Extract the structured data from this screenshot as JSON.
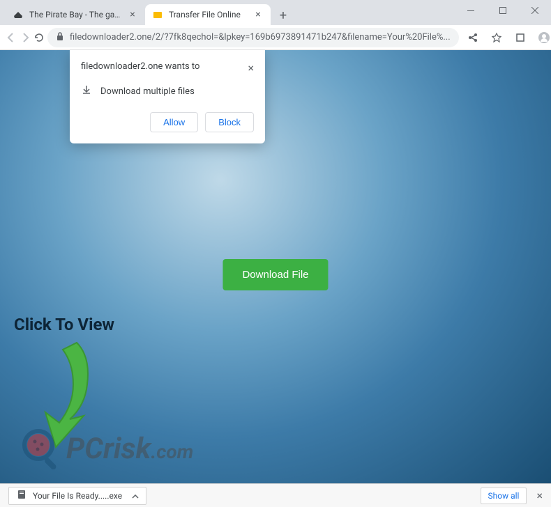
{
  "window": {
    "tabs": [
      {
        "title": "The Pirate Bay - The galaxy's mo...",
        "active": false,
        "favicon": "ship"
      },
      {
        "title": "Transfer File Online",
        "active": true,
        "favicon": "folder"
      }
    ]
  },
  "toolbar": {
    "url": "filedownloader2.one/2/?7fk8qechol=&lpkey=169b6973891471b247&filename=Your%20File%..."
  },
  "permission": {
    "title": "filedownloader2.one wants to",
    "body": "Download multiple files",
    "allow": "Allow",
    "block": "Block"
  },
  "page": {
    "download_button": "Download File",
    "click_to_view": "Click To View",
    "watermark_p": "P",
    "watermark_c": "C",
    "watermark_risk": "risk",
    "watermark_com": ".com"
  },
  "download_bar": {
    "file": "Your File Is Ready.....exe",
    "show_all": "Show all"
  }
}
